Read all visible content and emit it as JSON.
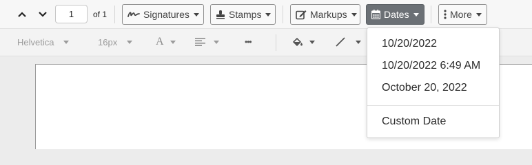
{
  "nav": {
    "page_value": "1",
    "page_count": "of 1"
  },
  "toolbar": {
    "signatures_label": "Signatures",
    "stamps_label": "Stamps",
    "markups_label": "Markups",
    "dates_label": "Dates",
    "more_label": "More"
  },
  "format": {
    "font_family": "Helvetica",
    "font_size": "16px",
    "text_glyph": "A",
    "more_glyph": "•••"
  },
  "dates_menu": {
    "open": true,
    "items": [
      "10/20/2022",
      "10/20/2022 6:49 AM",
      "October 20, 2022"
    ],
    "custom_label": "Custom Date"
  },
  "colors": {
    "active_button": "#6b7075",
    "toolbar_bg": "#f7f7f7",
    "page_bg": "#ffffff"
  },
  "icons": [
    "chevron-up-icon",
    "chevron-down-icon",
    "signature-icon",
    "stamp-icon",
    "markup-edit-icon",
    "calendar-icon",
    "vertical-dots-icon",
    "text-color-icon",
    "align-icon",
    "fill-icon",
    "line-icon"
  ]
}
